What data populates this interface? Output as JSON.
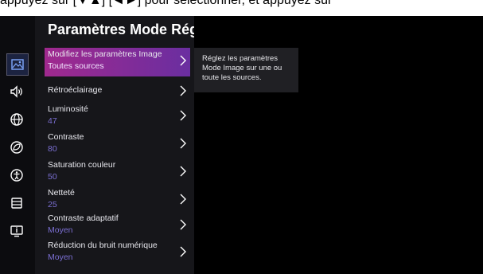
{
  "top_banner": {
    "text": "appuyez sur [▼▲] [◄►] pour sélectionner, et appuyez sur"
  },
  "panel": {
    "title": "Paramètres Mode Réglage"
  },
  "rail_icons": [
    "picture-icon",
    "sound-icon",
    "network-icon",
    "eco-icon",
    "accessibility-icon",
    "settings-list-icon",
    "tv-info-icon"
  ],
  "menu": [
    {
      "label": "Modifiez les paramètres Image",
      "value": "Toutes sources"
    },
    {
      "label": "Rétroéclairage",
      "value": ""
    },
    {
      "label": "Luminosité",
      "value": "47"
    },
    {
      "label": "Contraste",
      "value": "80"
    },
    {
      "label": "Saturation couleur",
      "value": "50"
    },
    {
      "label": "Netteté",
      "value": "25"
    },
    {
      "label": "Contraste adaptatif",
      "value": "Moyen"
    },
    {
      "label": "Réduction du bruit numérique",
      "value": "Moyen"
    }
  ],
  "tooltip": {
    "text": "Réglez les paramètres Mode Image sur une ou toute les sources."
  },
  "colors": {
    "accent_from": "#a0298e",
    "accent_to": "#6a2ea0",
    "value_text": "#7b6fd3"
  }
}
